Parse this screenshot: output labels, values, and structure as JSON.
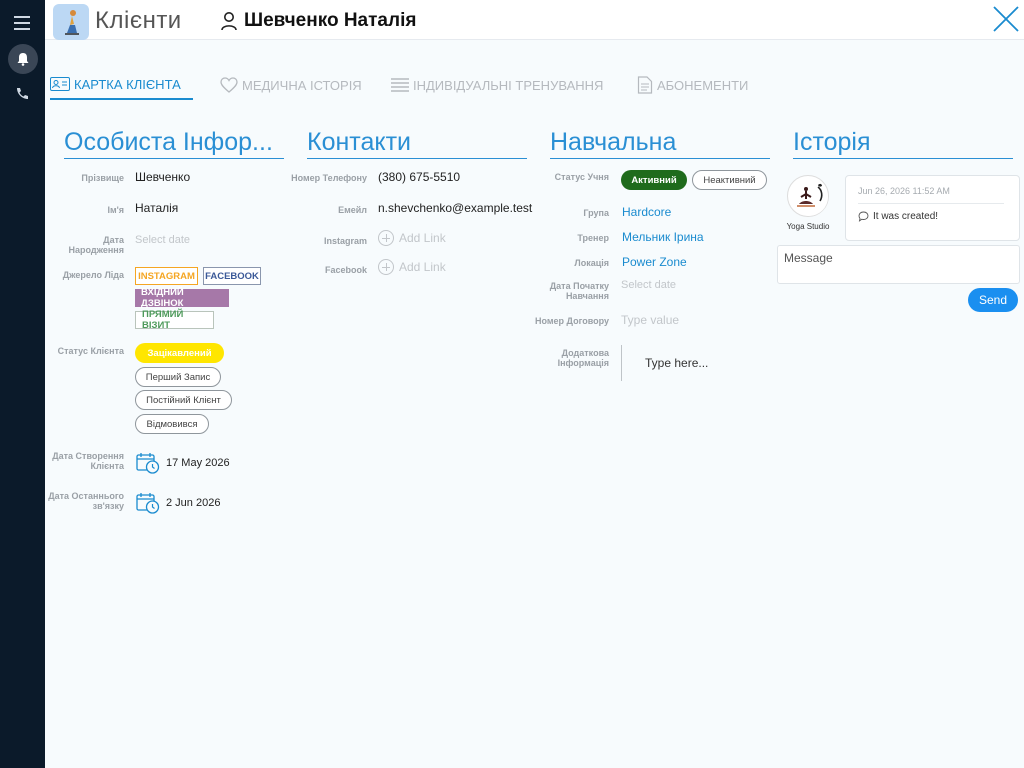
{
  "header": {
    "app_title": "Клієнти",
    "client_name": "Шевченко Наталія"
  },
  "tabs": [
    {
      "label": "КАРТКА КЛІЄНТА",
      "icon": "id-card-icon",
      "active": true
    },
    {
      "label": "МЕДИЧНА ІСТОРІЯ",
      "icon": "heart-icon",
      "active": false
    },
    {
      "label": "ІНДИВІДУАЛЬНІ ТРЕНУВАННЯ",
      "icon": "list-icon",
      "active": false
    },
    {
      "label": "АБОНЕМЕНТИ",
      "icon": "document-icon",
      "active": false
    }
  ],
  "personal": {
    "title": "Особиста Інфор...",
    "surname_label": "Прізвище",
    "surname": "Шевченко",
    "name_label": "Ім'я",
    "name": "Наталія",
    "birth_label_1": "Дата",
    "birth_label_2": "Народження",
    "birth_placeholder": "Select date",
    "lead_label": "Джерело Ліда",
    "lead_sources": [
      "INSTAGRAM",
      "FACEBOOK",
      "ВХІДНИЙ ДЗВІНОК",
      "ПРЯМИЙ ВІЗИТ"
    ],
    "status_label": "Статус Клієнта",
    "statuses": [
      "Зацікавлений",
      "Перший Запис",
      "Постійний Клієнт",
      "Відмовився"
    ],
    "created_label_1": "Дата Створення",
    "created_label_2": "Клієнта",
    "created_date": "17 May 2026",
    "last_contact_label_1": "Дата Останнього",
    "last_contact_label_2": "зв'язку",
    "last_contact_date": "2 Jun 2026"
  },
  "contacts": {
    "title": "Контакти",
    "phone_label": "Номер Телефону",
    "phone": "(380) 675-5510",
    "email_label": "Емейл",
    "email": "n.shevchenko@example.test",
    "instagram_label": "Instagram",
    "facebook_label": "Facebook",
    "add_link": "Add Link"
  },
  "training": {
    "title": "Навчальна",
    "status_label": "Статус Учня",
    "active_label": "Активний",
    "inactive_label": "Неактивний",
    "group_label": "Група",
    "group": "Hardcore",
    "trainer_label": "Тренер",
    "trainer": "Мельник Ірина",
    "location_label": "Локація",
    "location": "Power Zone",
    "start_label_1": "Дата Початку",
    "start_label_2": "Навчання",
    "start_placeholder": "Select date",
    "contract_label": "Номер Договору",
    "contract_placeholder": "Type value",
    "extra_label_1": "Додаткова",
    "extra_label_2": "Інформація",
    "extra_placeholder": "Type here..."
  },
  "history": {
    "title": "Історія",
    "studio_name": "Yoga Studio",
    "entry_date": "Jun 26, 2026 11:52 AM",
    "entry_text": "It was created!",
    "message_placeholder": "Message",
    "send_label": "Send"
  },
  "colors": {
    "accent": "#2a8fd4",
    "rail": "#0b1a2a",
    "active_green": "#1f6b1c",
    "interested_yellow": "#ffe600",
    "instagram": "#f5a623",
    "facebook": "#3b5998",
    "incoming_call": "#a678a8",
    "direct_visit": "#4e9a5b"
  }
}
